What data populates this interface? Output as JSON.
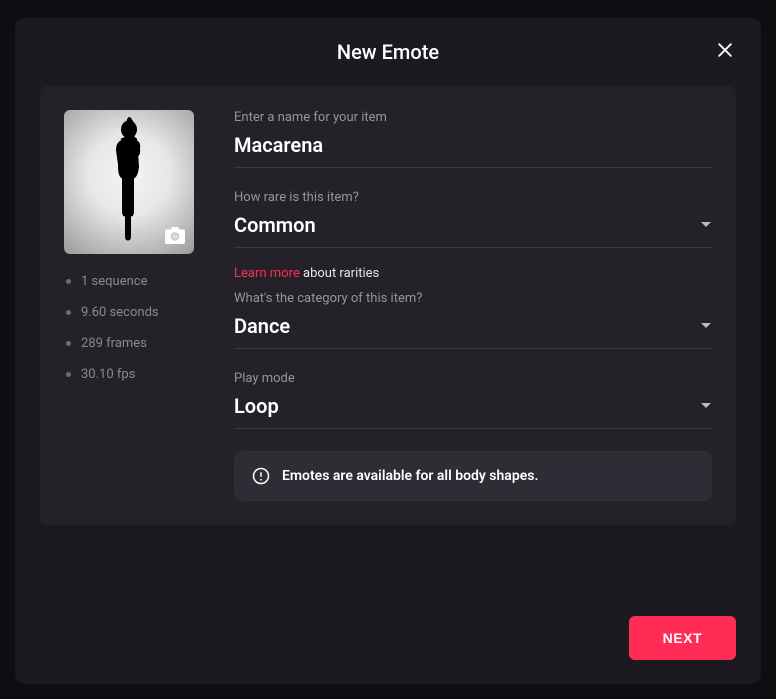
{
  "modal": {
    "title": "New Emote",
    "next_button": "NEXT"
  },
  "thumb": {
    "icon": "camera-icon"
  },
  "stats": {
    "sequence": "1 sequence",
    "duration": "9.60 seconds",
    "frames": "289 frames",
    "fps": "30.10 fps"
  },
  "fields": {
    "name": {
      "label": "Enter a name for your item",
      "value": "Macarena"
    },
    "rarity": {
      "label": "How rare is this item?",
      "value": "Common",
      "learn_link": "Learn more",
      "learn_rest": " about rarities"
    },
    "category": {
      "label": "What's the category of this item?",
      "value": "Dance"
    },
    "playmode": {
      "label": "Play mode",
      "value": "Loop"
    }
  },
  "info": {
    "message": "Emotes are available for all body shapes."
  },
  "colors": {
    "accent": "#ff2d55"
  }
}
